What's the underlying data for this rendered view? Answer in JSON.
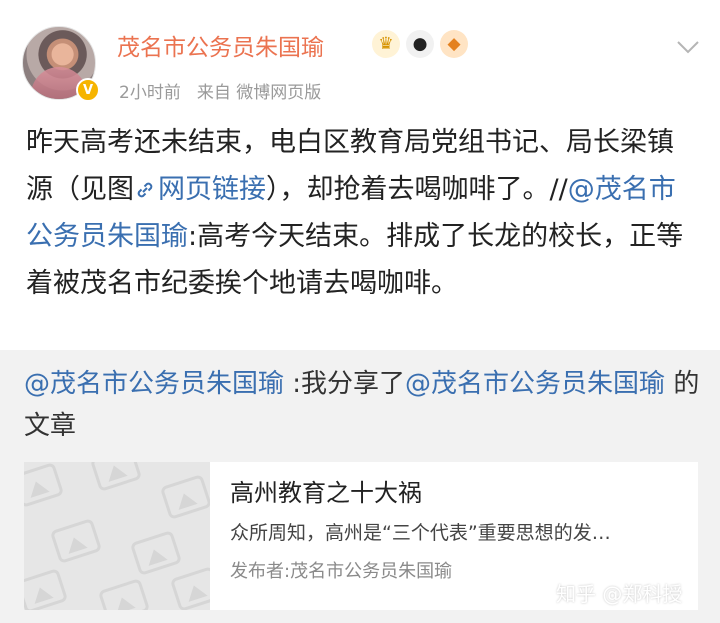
{
  "header": {
    "username": "茂名市公务员朱国瑜",
    "time": "2小时前",
    "source": "来自 微博网页版",
    "badges": [
      "crown-icon",
      "panda-icon",
      "fish-icon"
    ]
  },
  "post": {
    "text_1": "昨天高考还未结束，电白区教育局党组书记、局长梁镇源（见图",
    "link_text": "网页链接",
    "text_2": "），却抢着去喝咖啡了。//",
    "mention": "@茂名市公务员朱国瑜",
    "text_3": ":高考今天结束。排成了长龙的校长，正等着被茂名市纪委挨个地请去喝咖啡。"
  },
  "repost": {
    "mention_1": "@茂名市公务员朱国瑜",
    "text_1": " :我分享了",
    "mention_2": "@茂名市公务员朱国瑜",
    "text_2": " 的文章"
  },
  "card": {
    "title": "高州教育之十大祸",
    "description": "众所周知，高州是“三个代表”重要思想的发…",
    "author": "发布者:茂名市公务员朱国瑜"
  },
  "watermark": "知乎 @郑科授",
  "colors": {
    "username": "#eb7350",
    "link": "#3a6fb0",
    "meta": "#9a9a9a",
    "repost_bg": "#f2f2f2"
  }
}
